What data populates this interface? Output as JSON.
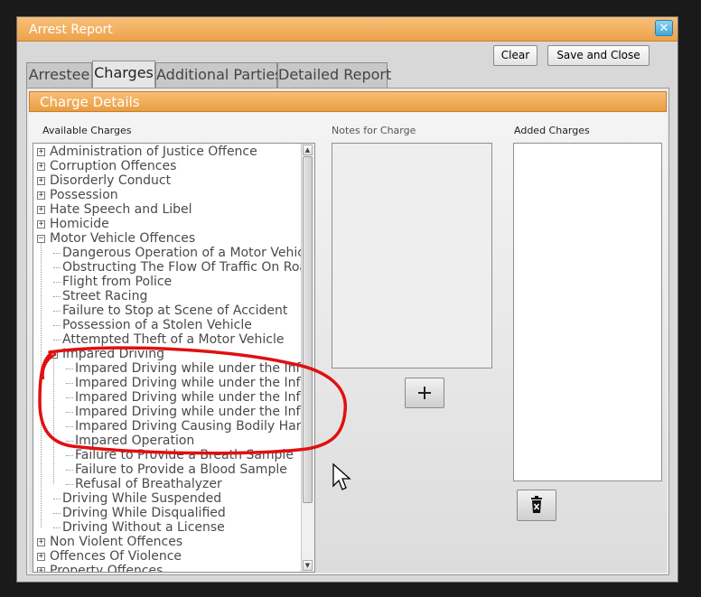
{
  "window": {
    "title": "Arrest Report",
    "close_glyph": "✕"
  },
  "buttons": {
    "clear": "Clear",
    "save_close": "Save and Close"
  },
  "tabs": [
    {
      "label": "Arrestee",
      "active": false
    },
    {
      "label": "Charges",
      "active": true
    },
    {
      "label": "Additional Parties",
      "active": false
    },
    {
      "label": "Detailed Report",
      "active": false
    }
  ],
  "panel": {
    "title": "Charge Details",
    "available_label": "Available Charges",
    "notes_label": "Notes for Charge",
    "added_label": "Added Charges"
  },
  "tree": [
    {
      "label": "Administration of Justice Offence",
      "level": 0,
      "expander": "plus"
    },
    {
      "label": "Corruption Offences",
      "level": 0,
      "expander": "plus"
    },
    {
      "label": "Disorderly Conduct",
      "level": 0,
      "expander": "plus"
    },
    {
      "label": "Possession",
      "level": 0,
      "expander": "plus"
    },
    {
      "label": "Hate Speech and Libel",
      "level": 0,
      "expander": "plus"
    },
    {
      "label": "Homicide",
      "level": 0,
      "expander": "plus"
    },
    {
      "label": "Motor Vehicle Offences",
      "level": 0,
      "expander": "minus"
    },
    {
      "label": "Dangerous Operation of a Motor Vehicle",
      "level": 1,
      "expander": "none"
    },
    {
      "label": "Obstructing The Flow Of Traffic On Roadway",
      "level": 1,
      "expander": "none"
    },
    {
      "label": "Flight from Police",
      "level": 1,
      "expander": "none"
    },
    {
      "label": "Street Racing",
      "level": 1,
      "expander": "none"
    },
    {
      "label": "Failure to Stop at Scene of Accident",
      "level": 1,
      "expander": "none"
    },
    {
      "label": "Possession of a Stolen Vehicle",
      "level": 1,
      "expander": "none"
    },
    {
      "label": "Attempted Theft of a Motor Vehicle",
      "level": 1,
      "expander": "none"
    },
    {
      "label": "Impared Driving",
      "level": 1,
      "expander": "minus"
    },
    {
      "label": "Impared Driving while under the Influence",
      "level": 2,
      "expander": "none"
    },
    {
      "label": "Impared Driving while under the Influence",
      "level": 2,
      "expander": "none"
    },
    {
      "label": "Impared Driving while under the Influence",
      "level": 2,
      "expander": "none"
    },
    {
      "label": "Impared Driving while under the Influence",
      "level": 2,
      "expander": "none"
    },
    {
      "label": "Impared Driving Causing Bodily Harm",
      "level": 2,
      "expander": "none"
    },
    {
      "label": "Impared Operation",
      "level": 2,
      "expander": "none"
    },
    {
      "label": "Failure to Provide a Breath Sample",
      "level": 2,
      "expander": "none"
    },
    {
      "label": "Failure to Provide a Blood Sample",
      "level": 2,
      "expander": "none"
    },
    {
      "label": "Refusal of Breathalyzer",
      "level": 2,
      "expander": "none"
    },
    {
      "label": "Driving While Suspended",
      "level": 1,
      "expander": "none"
    },
    {
      "label": "Driving While Disqualified",
      "level": 1,
      "expander": "none"
    },
    {
      "label": "Driving Without a License",
      "level": 1,
      "expander": "none"
    },
    {
      "label": "Non Violent Offences",
      "level": 0,
      "expander": "plus"
    },
    {
      "label": "Offences Of Violence",
      "level": 0,
      "expander": "plus"
    },
    {
      "label": "Property Offences",
      "level": 0,
      "expander": "plus"
    }
  ],
  "icons": {
    "add": "plus-icon",
    "delete": "trash-icon",
    "scroll_up": "▲",
    "scroll_down": "▼"
  },
  "colors": {
    "accent": "#eda24a",
    "annotation": "#e01010"
  }
}
